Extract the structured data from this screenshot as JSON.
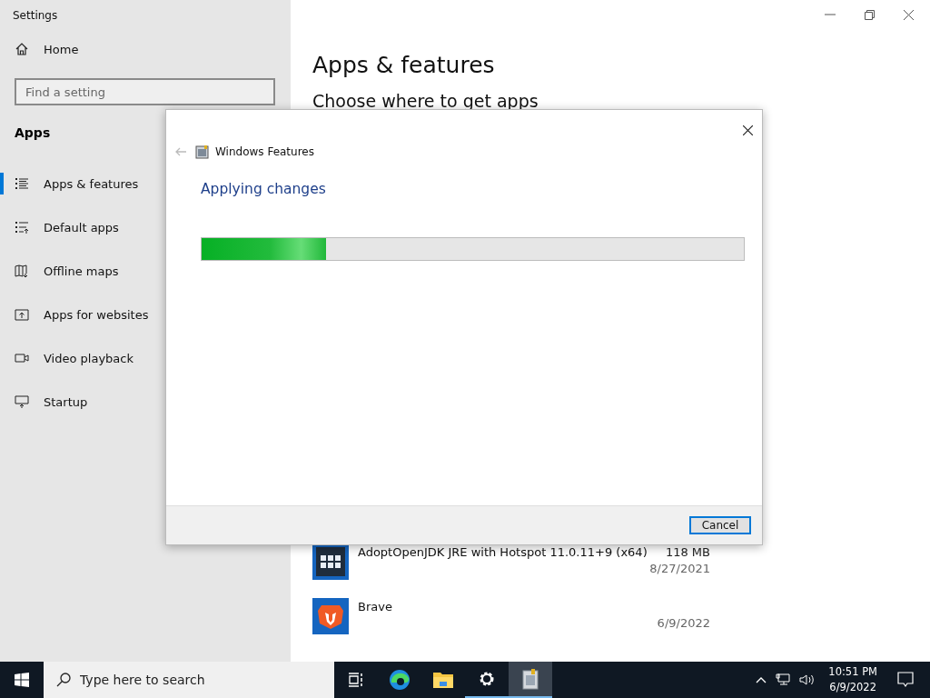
{
  "window": {
    "title": "Settings"
  },
  "sidebar": {
    "home": "Home",
    "search": {
      "placeholder": "Find a setting"
    },
    "section": "Apps",
    "items": [
      {
        "label": "Apps & features",
        "kind": "list",
        "selected": true
      },
      {
        "label": "Default apps",
        "kind": "defaults",
        "selected": false
      },
      {
        "label": "Offline maps",
        "kind": "map",
        "selected": false
      },
      {
        "label": "Apps for websites",
        "kind": "web",
        "selected": false
      },
      {
        "label": "Video playback",
        "kind": "video",
        "selected": false
      },
      {
        "label": "Startup",
        "kind": "startup",
        "selected": false
      }
    ]
  },
  "main": {
    "title": "Apps & features",
    "subtitle": "Choose where to get apps",
    "apps": [
      {
        "name": "AdoptOpenJDK JRE with Hotspot 11.0.11+9 (x64)",
        "size": "118 MB",
        "date": "8/27/2021",
        "kind": "grid"
      },
      {
        "name": "Brave",
        "date": "6/9/2022",
        "kind": "lion"
      }
    ]
  },
  "dialog": {
    "title": "Windows Features",
    "heading": "Applying changes",
    "progress": {
      "level": 0.23
    },
    "buttons": [
      "Cancel"
    ]
  },
  "taskbar": {
    "search": {
      "placeholder": "Type here to search"
    },
    "apps": [
      {
        "kind": "taskview",
        "active": false
      },
      {
        "kind": "edge",
        "active": false
      },
      {
        "kind": "explorer",
        "active": false
      },
      {
        "kind": "settings",
        "active": true
      },
      {
        "kind": "features",
        "active": true
      }
    ],
    "time": "10:51 PM",
    "date": "6/9/2022"
  }
}
